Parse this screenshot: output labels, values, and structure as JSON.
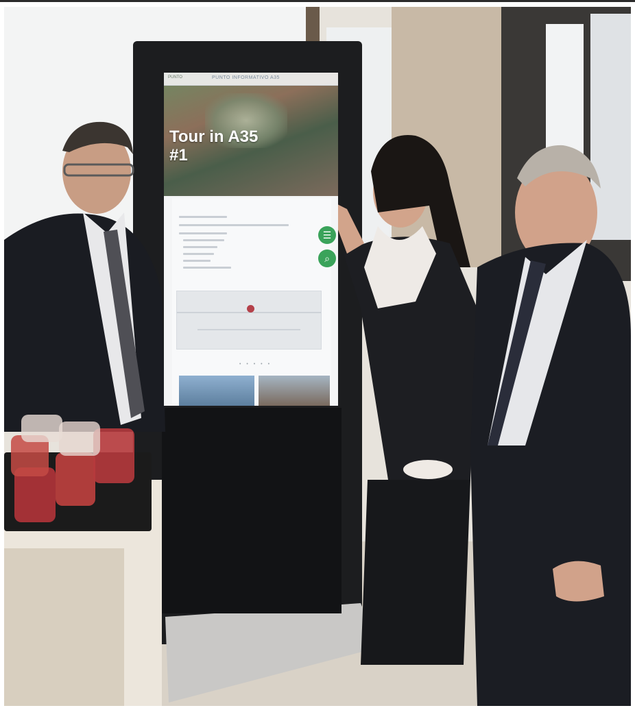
{
  "photo": {
    "kiosk": {
      "topbar": {
        "brand": "PUNTO",
        "title": "PUNTO INFORMATIVO A35"
      },
      "hero_title": "Tour in A35 #1",
      "hero_title_line1": "Tour in A35",
      "hero_title_line2": "#1",
      "menu_icon": "hamburger-menu-icon",
      "search_icon": "search-icon",
      "pagination": "• • • • •"
    },
    "colors": {
      "kiosk_frame": "#1c1d1f",
      "accent_green": "#3aa35a",
      "drink": "#b3343a",
      "pin": "#b4414a"
    }
  }
}
